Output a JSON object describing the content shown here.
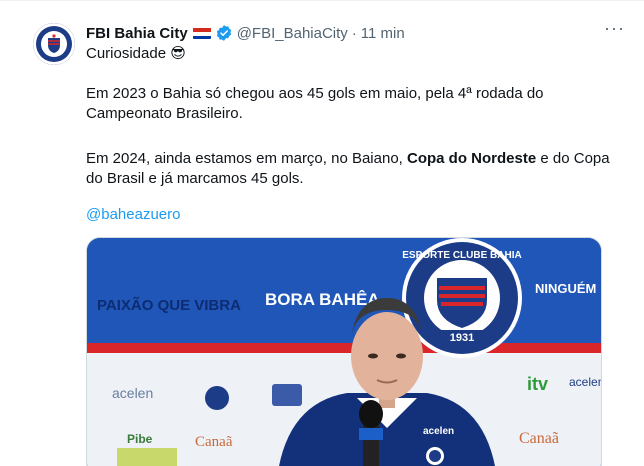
{
  "author": {
    "name": "FBI Bahia City",
    "handle": "@FBI_BahiaCity",
    "separator": "·",
    "time": "11 min",
    "flag_icon": "paraguay-flag-icon",
    "verified_icon": "verified-badge-icon"
  },
  "tweet": {
    "line1_text": "Curiosidade",
    "line1_emoji": "😎",
    "para1": "Em 2023 o Bahia só chegou aos 45 gols em maio, pela 4ª rodada do Campeonato Brasileiro.",
    "para2_before": "Em 2024, ainda estamos em março, no Baiano, ",
    "para2_bold": "Copa do Nordeste",
    "para2_after": " e do Copa do Brasil e já marcamos 45 gols.",
    "mention": "@baheazuero"
  },
  "media": {
    "banner_texts": [
      "PAIXÃO QUE VIBRA",
      "BORA BAHÊA",
      "NINGUÉM"
    ],
    "crest_text": "ESPORTE CLUBE BAHIA",
    "crest_year": "1931",
    "sponsors": [
      "acelen",
      "itv",
      "Canaã",
      "Canaã",
      "Pibe",
      "acelen"
    ],
    "jersey_text": "acelen",
    "colors": {
      "banner_blue": "#1f56b8",
      "dark_blue": "#13307a",
      "red": "#d8262b",
      "accent_link": "#1d9bf0"
    }
  },
  "ui": {
    "more_icon": "more-dots-icon"
  }
}
